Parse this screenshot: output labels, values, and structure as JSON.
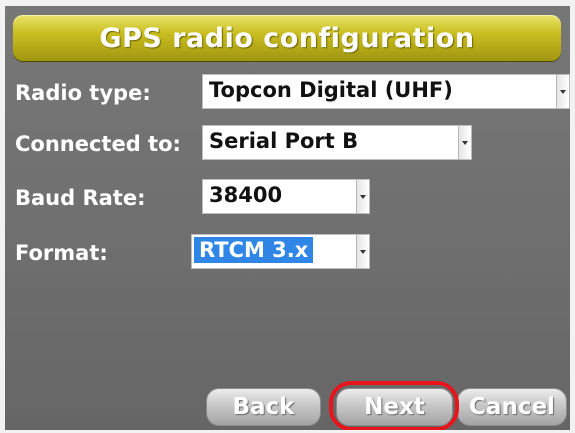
{
  "title": "GPS radio configuration",
  "fields": {
    "radio_type": {
      "label": "Radio type:",
      "value": "Topcon Digital (UHF)"
    },
    "connected_to": {
      "label": "Connected to:",
      "value": "Serial Port B"
    },
    "baud_rate": {
      "label": "Baud Rate:",
      "value": "38400"
    },
    "format": {
      "label": "Format:",
      "value": "RTCM 3.x"
    }
  },
  "buttons": {
    "back": "Back",
    "next": "Next",
    "cancel": "Cancel"
  },
  "colors": {
    "title_bar": "#c9be1f",
    "panel": "#737373",
    "selection": "#2f86e6",
    "annotation": "#e8141b"
  }
}
